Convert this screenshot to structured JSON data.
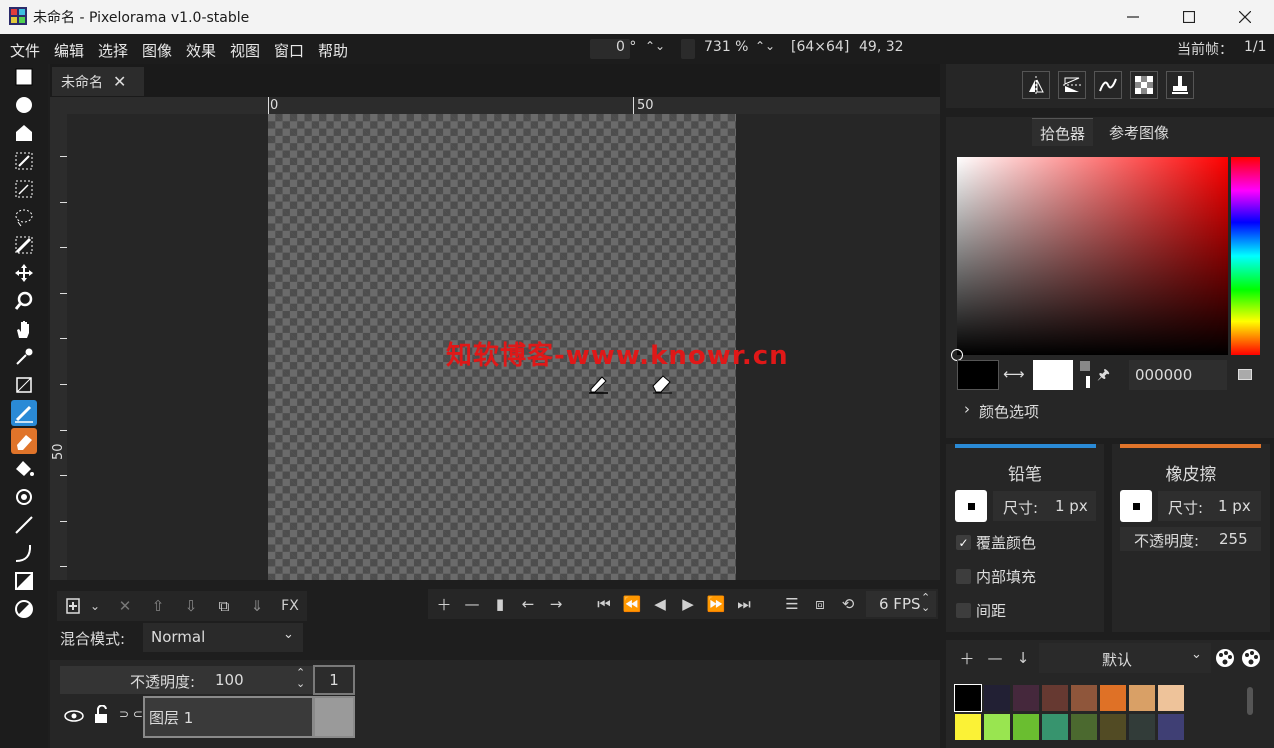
{
  "window": {
    "title": "未命名 - Pixelorama v1.0-stable",
    "minimize": "—",
    "maximize": "☐",
    "close": "✕"
  },
  "menu": [
    "文件",
    "编辑",
    "选择",
    "图像",
    "效果",
    "视图",
    "窗口",
    "帮助"
  ],
  "status": {
    "rotation": "0 °",
    "zoom": "731 %",
    "canvas_size": "[64×64]",
    "cursor_pos": "49, 32",
    "current_frame_label": "当前帧：",
    "current_frame": "1/1"
  },
  "tab": {
    "label": "未命名",
    "close": "✕"
  },
  "rulers": {
    "h0": "0",
    "h50": "50",
    "v50": "50"
  },
  "watermark": "知软博客-www.knowr.cn",
  "tools": [
    "rectangle-select",
    "ellipse-select",
    "polygon-select",
    "color-select",
    "magic-wand",
    "lasso",
    "pencil-select",
    "move",
    "zoom",
    "pan",
    "color-picker",
    "crop",
    "pencil",
    "eraser",
    "bucket",
    "shading",
    "line",
    "curve",
    "rectangle",
    "ellipse"
  ],
  "timeline": {
    "layer_fx": "FX",
    "fps": "6 FPS",
    "blend_label": "混合模式:",
    "blend_value": "Normal",
    "opacity_label": "不透明度:",
    "opacity_value": "100",
    "frame_number": "1",
    "layer_name": "图层 1"
  },
  "color_picker": {
    "tab_picker": "拾色器",
    "tab_reference": "参考图像",
    "primary_color": "#000000",
    "secondary_color": "#ffffff",
    "hex_value": "000000",
    "options_label": "颜色选项"
  },
  "left_tool": {
    "title": "铅笔",
    "accent": "#2a8ad6",
    "size_label": "尺寸:",
    "size_value": "1 px",
    "overwrite": "覆盖颜色",
    "overwrite_checked": true,
    "fill_inside": "内部填充",
    "spacing": "间距"
  },
  "right_tool": {
    "title": "橡皮擦",
    "accent": "#e0742a",
    "size_label": "尺寸:",
    "size_value": "1 px",
    "opacity_label": "不透明度:",
    "opacity_value": "255"
  },
  "palette": {
    "name": "默认",
    "colors": [
      "#000000",
      "#222034",
      "#45283c",
      "#663931",
      "#8f563b",
      "#df7126",
      "#d9a066",
      "#eec39a",
      "#fbf236",
      "#99e550",
      "#6abe30",
      "#37946e",
      "#4b692f",
      "#524b24",
      "#323c39",
      "#3f3f74"
    ]
  }
}
